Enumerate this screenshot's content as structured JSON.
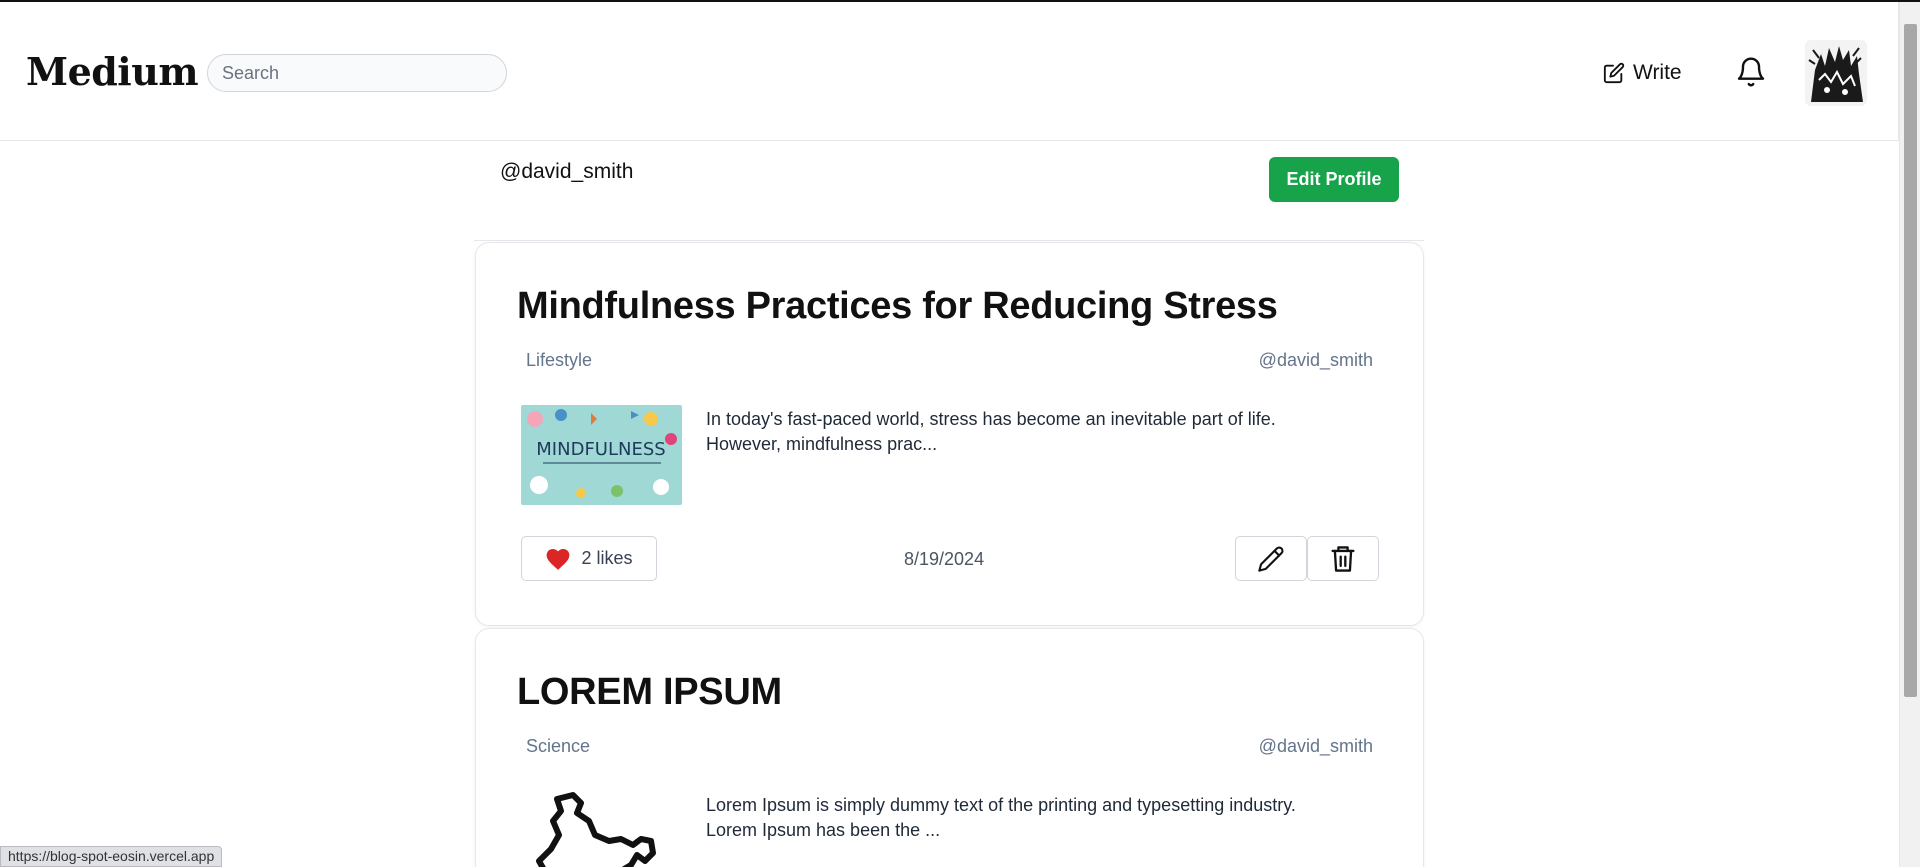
{
  "header": {
    "logo": "Medium",
    "search_placeholder": "Search",
    "write_label": "Write"
  },
  "profile": {
    "username": "@david_smith",
    "edit_button": "Edit Profile"
  },
  "posts": [
    {
      "title": "Mindfulness Practices for Reducing Stress",
      "category": "Lifestyle",
      "author": "@david_smith",
      "excerpt": "In today's fast-paced world, stress has become an inevitable part of life. However, mindfulness prac...",
      "likes": "2 likes",
      "date": "8/19/2024",
      "thumb_text": "MINDFULNESS"
    },
    {
      "title": "LOREM IPSUM",
      "category": "Science",
      "author": "@david_smith",
      "excerpt": "Lorem Ipsum is simply dummy text of the printing and typesetting industry. Lorem Ipsum has been the ..."
    }
  ],
  "status_bar": {
    "url": "https://blog-spot-eosin.vercel.app"
  },
  "colors": {
    "accent_green": "#16a34a",
    "like_red": "#dc2626"
  }
}
